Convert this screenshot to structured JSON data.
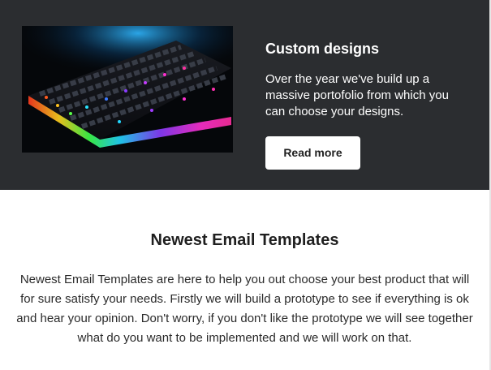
{
  "hero": {
    "image_icon": "rgb-mechanical-keyboard-photo",
    "title": "Custom designs",
    "text": "Over the year we've build up a massive portofolio from which you can choose your designs.",
    "button_label": "Read more",
    "background": "#2b2d30"
  },
  "section": {
    "title": "Newest Email Templates",
    "text": "Newest Email Templates are here to help you out choose your best product that will for sure satisfy your needs. Firstly we will build a prototype to see if everything is ok and hear your opinion. Don't worry, if you don't like the prototype we will see together what do you want to be implemented and we will work on that."
  }
}
